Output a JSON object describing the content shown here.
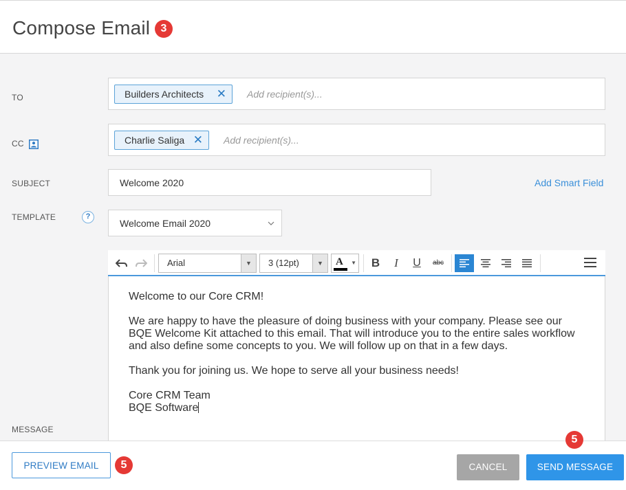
{
  "header": {
    "title": "Compose Email",
    "badge": "3"
  },
  "form": {
    "to": {
      "label": "TO",
      "chips": [
        {
          "label": "Builders Architects"
        }
      ],
      "placeholder": "Add recipient(s)..."
    },
    "cc": {
      "label": "CC",
      "chips": [
        {
          "label": "Charlie Saliga"
        }
      ],
      "placeholder": "Add recipient(s)..."
    },
    "subject": {
      "label": "SUBJECT",
      "value": "Welcome 2020",
      "smart_field_link": "Add Smart Field"
    },
    "template": {
      "label": "TEMPLATE",
      "help": "?",
      "selected": "Welcome Email 2020"
    },
    "message": {
      "label": "MESSAGE"
    }
  },
  "toolbar": {
    "font_family": "Arial",
    "font_size": "3 (12pt)",
    "font_color_glyph": "A",
    "bold": "B",
    "italic": "I",
    "underline": "U",
    "strike": "abc",
    "active_alignment": "left"
  },
  "editor": {
    "paragraphs": [
      "Welcome to our Core CRM!",
      "We are happy to have the pleasure of doing business with your company. Please see our BQE Welcome Kit attached to this email. That will introduce you to the entire sales workflow and also define some concepts to you. We will follow up on that in a few days.",
      "Thank you for joining us. We hope to serve all your business needs!",
      "Core CRM Team",
      "BQE Software"
    ]
  },
  "footer": {
    "preview_label": "PREVIEW EMAIL",
    "preview_badge": "5",
    "cancel_label": "CANCEL",
    "send_label": "SEND MESSAGE",
    "send_badge": "5"
  },
  "colors": {
    "accent": "#2f95e8",
    "badge": "#e53935",
    "cancel": "#a6a6a6"
  }
}
